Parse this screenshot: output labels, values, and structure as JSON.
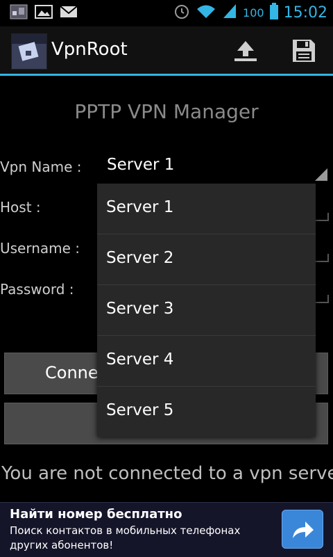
{
  "status_bar": {
    "battery_level": "100",
    "time": "15:02",
    "left_icons": [
      "photo-thumbnail-icon",
      "gallery-icon",
      "mail-icon"
    ],
    "right_icons": [
      "alarm-icon",
      "wifi-icon",
      "signal-icon",
      "battery-icon"
    ]
  },
  "action_bar": {
    "title": "VpnRoot",
    "actions": [
      "upload-icon",
      "save-icon"
    ]
  },
  "form": {
    "heading": "PPTP VPN Manager",
    "vpn_name_label": "Vpn Name :",
    "vpn_name_value": "Server 1",
    "host_label": "Host :",
    "username_label": "Username :",
    "password_label": "Password :"
  },
  "buttons": {
    "connect_partial": "Conne"
  },
  "dropdown": {
    "options": [
      "Server 1",
      "Server 2",
      "Server 3",
      "Server 4",
      "Server 5"
    ]
  },
  "status_message": "You are not connected to a vpn server",
  "ad": {
    "title": "Найти номер бесплатно",
    "subtitle": "Поиск контактов в мобильных телефонах других абонентов!"
  },
  "colors": {
    "accent": "#33b5e5",
    "background": "#000000",
    "dropdown_bg": "#282828",
    "ad_button": "#3a87d9"
  }
}
